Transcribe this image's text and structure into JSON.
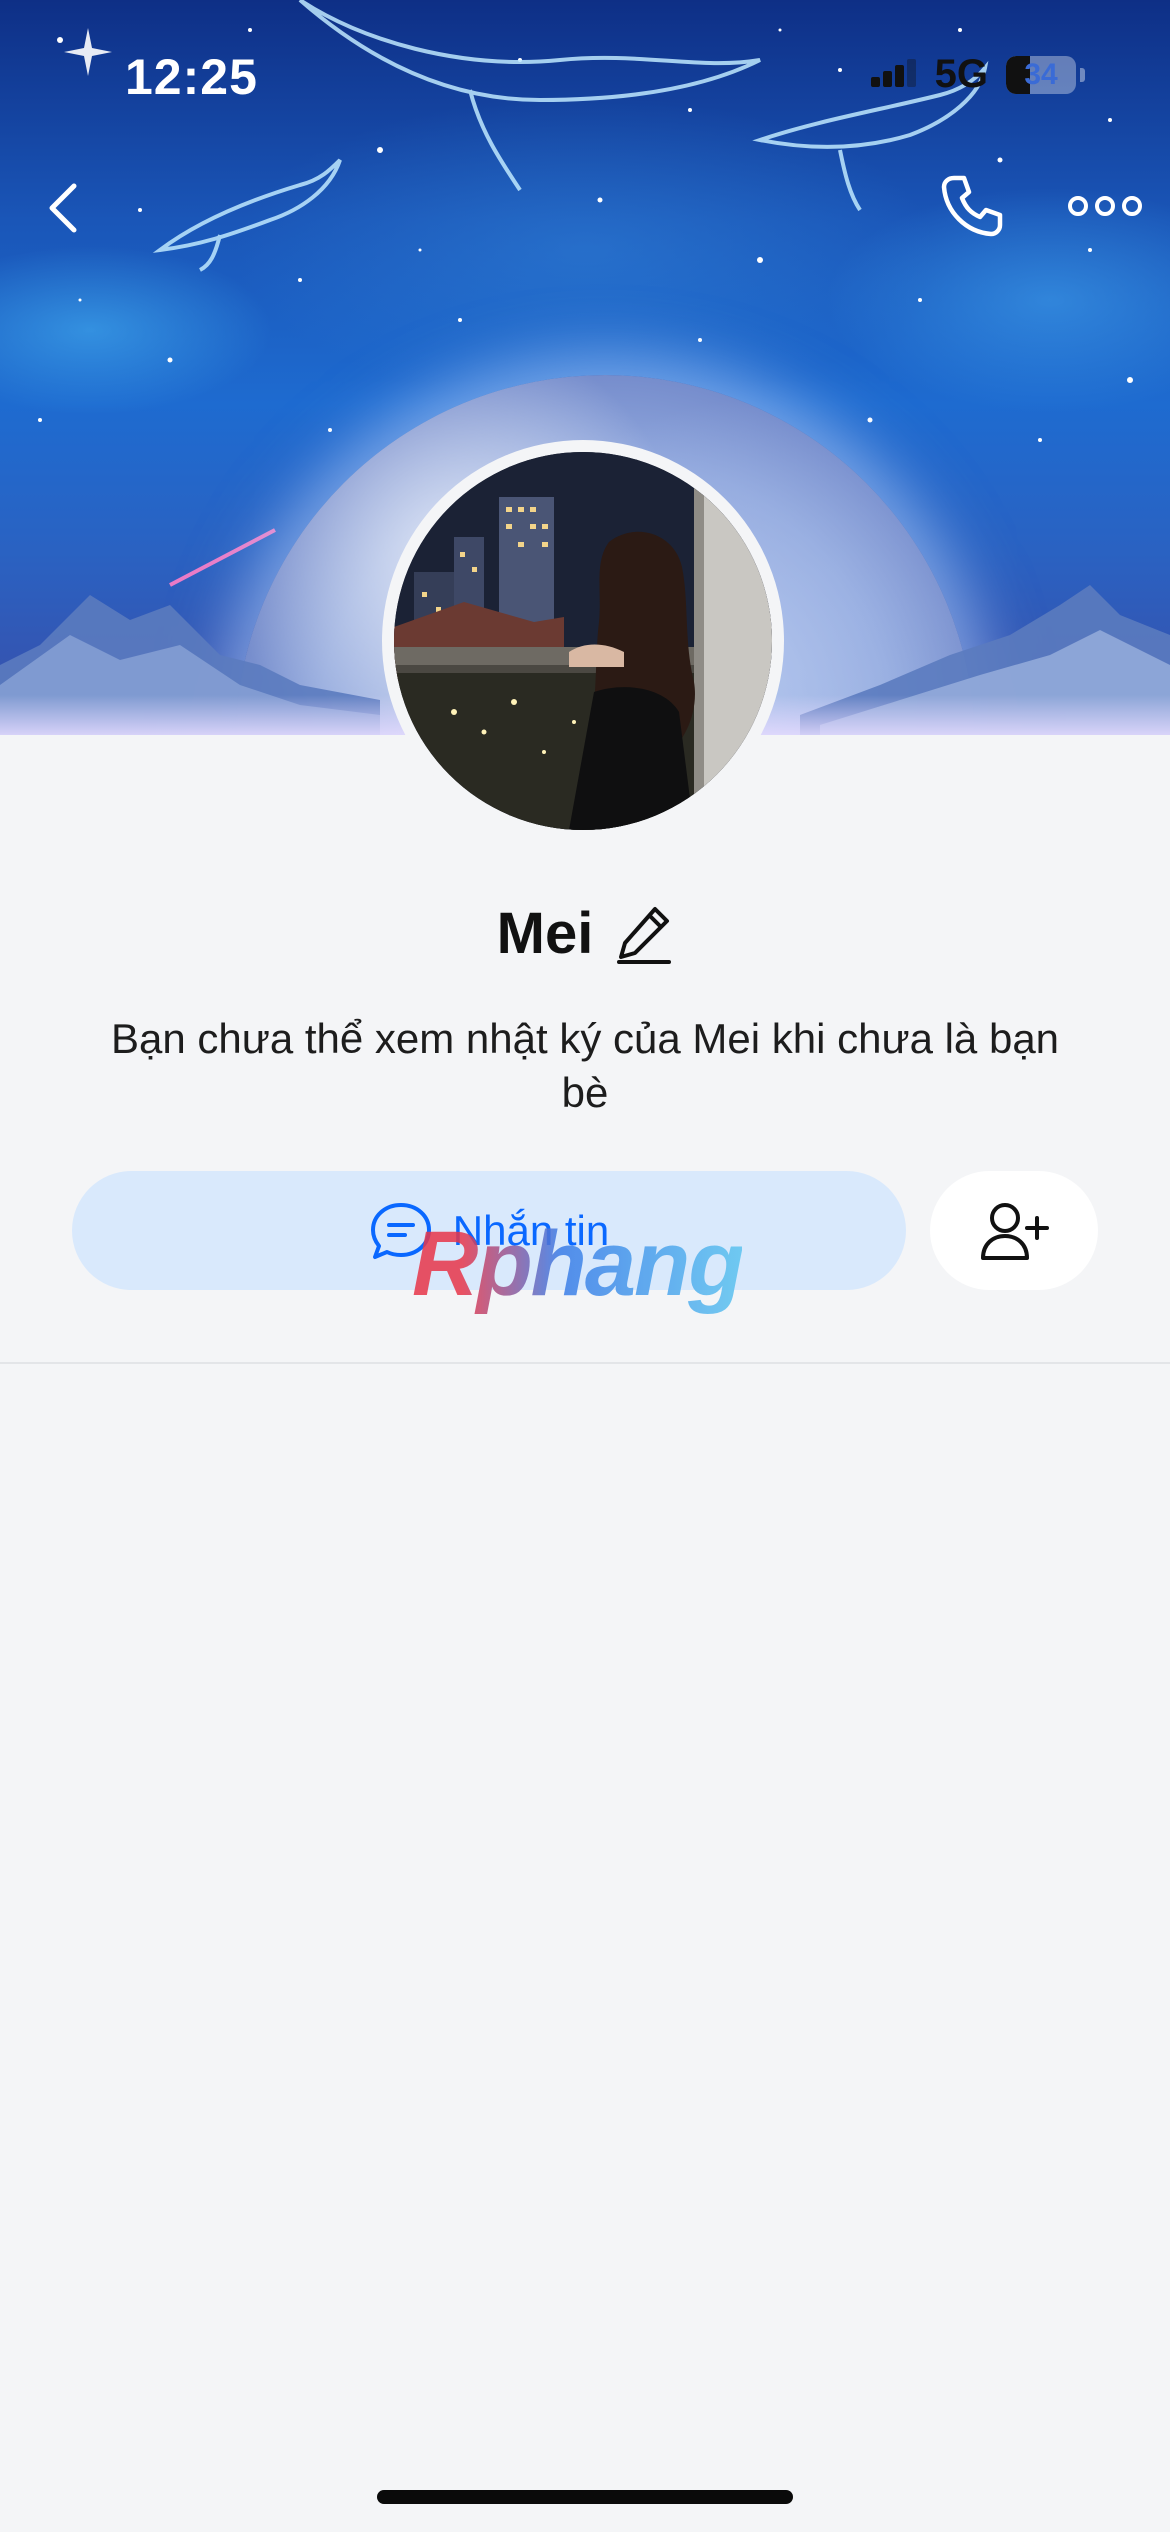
{
  "status_bar": {
    "time": "12:25",
    "network": "5G",
    "battery_level": "34",
    "battery_fraction": 0.34
  },
  "nav": {
    "back_icon": "chevron-left-icon",
    "call_icon": "phone-icon",
    "more_icon": "more-horizontal-icon"
  },
  "profile": {
    "name": "Mei",
    "edit_icon": "pencil-icon",
    "notice": "Bạn chưa thể xem nhật ký của Mei khi chưa là bạn bè"
  },
  "actions": {
    "message_label": "Nhắn tin",
    "message_icon": "chat-bubble-icon",
    "add_friend_icon": "add-user-icon"
  },
  "watermark": "Rphang",
  "colors": {
    "accent": "#0a68ff",
    "message_button_bg": "#d9e9fc",
    "page_bg": "#f4f5f7"
  }
}
